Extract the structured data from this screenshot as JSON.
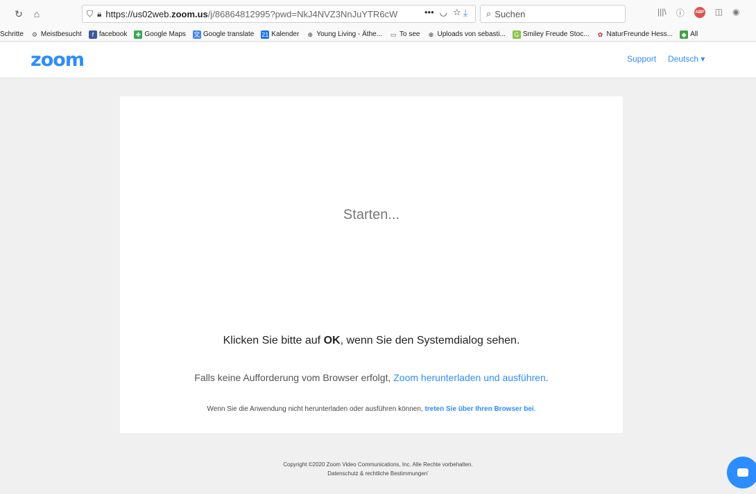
{
  "browser": {
    "url_prefix": "https://us02web.",
    "url_host": "zoom.us",
    "url_rest": "/j/86864812995?pwd=NkJ4NVZ3NnJuYTR6cW",
    "search_placeholder": "Suchen"
  },
  "bookmarks": [
    {
      "label": "Schritte",
      "icon": ""
    },
    {
      "label": "Meistbesucht",
      "icon": "gear-icon"
    },
    {
      "label": "facebook",
      "icon": "facebook-icon"
    },
    {
      "label": "Google Maps",
      "icon": "maps-icon"
    },
    {
      "label": "Google translate",
      "icon": "translate-icon"
    },
    {
      "label": "Kalender",
      "icon": "calendar-icon"
    },
    {
      "label": "Young Living - Äthe...",
      "icon": "globe-icon"
    },
    {
      "label": "To see",
      "icon": "folder-icon"
    },
    {
      "label": "Uploads von sebasti...",
      "icon": "globe-icon"
    },
    {
      "label": "Smiley Freude Stoc...",
      "icon": "smiley-icon"
    },
    {
      "label": "NaturFreunde Hess...",
      "icon": "flower-icon"
    },
    {
      "label": "All",
      "icon": "green-icon"
    }
  ],
  "header": {
    "logo": "zoom",
    "support": "Support",
    "language": "Deutsch ▾"
  },
  "main": {
    "starting": "Starten...",
    "klicken_pre": "Klicken Sie bitte auf ",
    "klicken_bold": "OK",
    "klicken_post": ", wenn Sie den Systemdialog sehen.",
    "falls_text": "Falls keine Aufforderung vom Browser erfolgt, ",
    "falls_link": "Zoom herunterladen und ausführen",
    "falls_end": ".",
    "wenn_text": "Wenn Sie die Anwendung nicht herunterladen oder ausführen können, ",
    "wenn_link": "treten Sie über Ihren Browser bei",
    "wenn_end": "."
  },
  "footer": {
    "copyright": "Copyright ©2020 Zoom Video Communications, Inc. Alle Rechte vorbehalten.",
    "privacy": "Datenschutz & rechtliche Bestimmungen'"
  },
  "colors": {
    "accent": "#2d8cff",
    "background": "#f0f0f0"
  }
}
